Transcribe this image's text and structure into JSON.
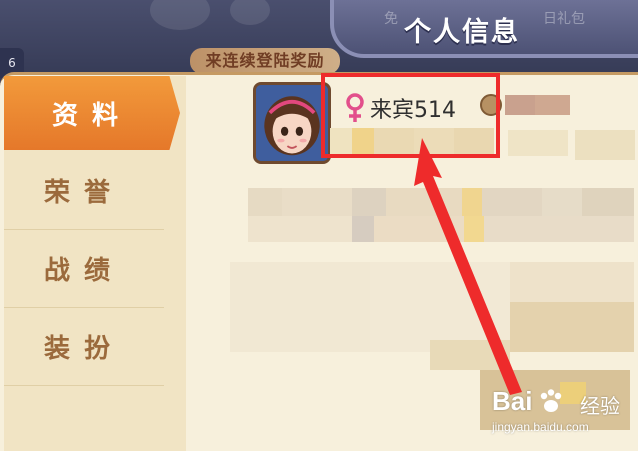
{
  "header": {
    "title": "个人信息",
    "sub_left": "免",
    "sub_right": "日礼包"
  },
  "background": {
    "level_badge": "6",
    "banner_text": "来连续登陆奖励"
  },
  "sidebar": {
    "items": [
      {
        "label": "资料",
        "active": true
      },
      {
        "label": "荣誉",
        "active": false
      },
      {
        "label": "战绩",
        "active": false
      },
      {
        "label": "装扮",
        "active": false
      }
    ]
  },
  "profile": {
    "name": "来宾514",
    "gender_icon": "female-icon",
    "gender_color": "#e24f8b",
    "coin_icon": "coin-icon"
  },
  "annotation": {
    "box_color": "#ee2b2b",
    "arrow_color": "#ee2b2b"
  },
  "watermark": {
    "brand": "Bai",
    "brand_suffix": "经验",
    "url": "jingyan.baidu.com"
  }
}
